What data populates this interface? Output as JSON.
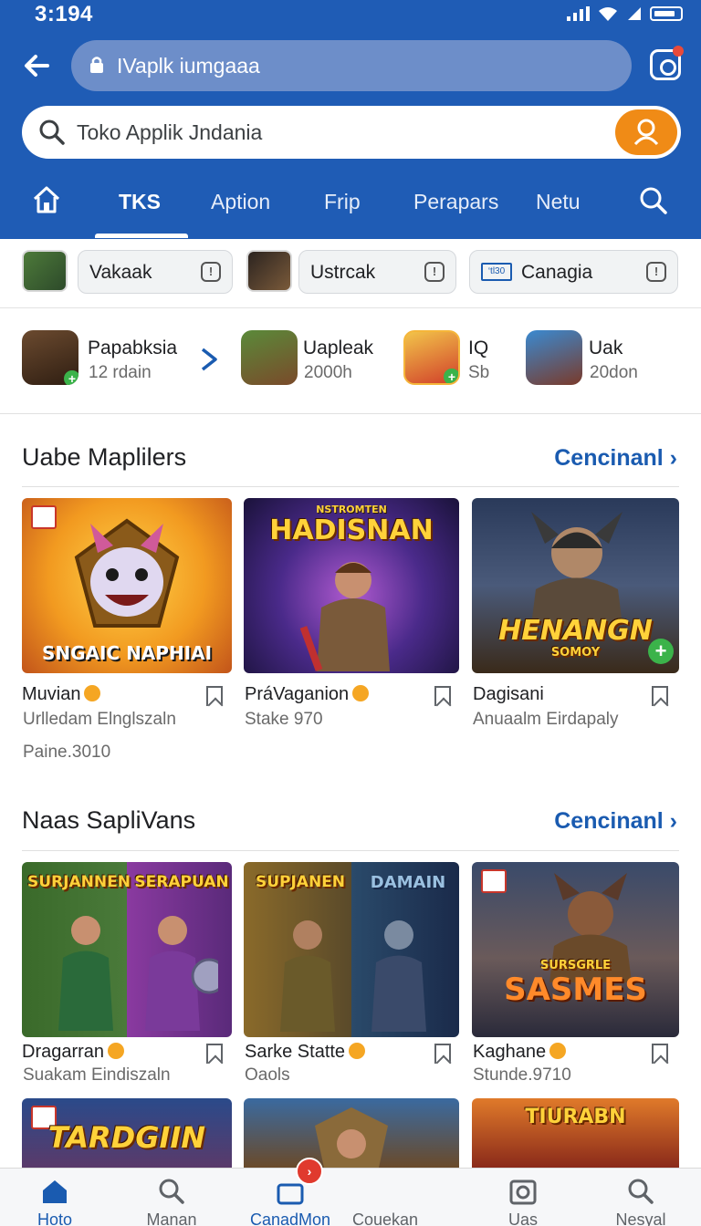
{
  "status_bar": {
    "time": "3:194"
  },
  "url_bar": {
    "text": "IVaplk iumgaaa"
  },
  "search": {
    "text": "Toko Applik Jndania"
  },
  "nav_tabs": [
    "TKS",
    "Aption",
    "Frip",
    "Perapars",
    "Netu"
  ],
  "chips": [
    {
      "label": "Vakaak",
      "icon": "game-thumbnail-icon"
    },
    {
      "label": "Ustrcak",
      "icon": "game-thumbnail-icon"
    },
    {
      "label": "Canagia",
      "icon": "game-thumbnail-icon",
      "badge": "‘tl30"
    }
  ],
  "apps": [
    {
      "name": "Papabksia",
      "sub": "12 rdain"
    },
    {
      "name": "Uapleak",
      "sub": "2000h"
    },
    {
      "name": "IQ",
      "sub": "Sb"
    },
    {
      "name": "Uak",
      "sub": "20don"
    }
  ],
  "section1": {
    "title": "Uabe Maplilers",
    "link": "Cencinanl",
    "cards": [
      {
        "art": "SNGAIC NAPHIAI",
        "title": "Muvian",
        "sub": "Urlledam Elnglszaln",
        "extra": "Paine.3010"
      },
      {
        "art": "HADISNAN",
        "art_small": "NSTROMTEN",
        "title": "PráVaganion",
        "sub": "Stake 970"
      },
      {
        "art": "HENANGN",
        "art_small": "SOMOY",
        "title": "Dagisani",
        "sub": "Anuaalm Eirdapaly"
      }
    ]
  },
  "section2": {
    "title": "Naas SapliVans",
    "link": "Cencinanl",
    "cards": [
      {
        "art": "SURJANNEN",
        "art2": "SERAPUAN",
        "title": "Dragarran",
        "sub": "Suakam Eindiszaln"
      },
      {
        "art": "SUPJANEN",
        "art2": "DAMAIN",
        "title": "Sarke Statte",
        "sub": "Oaols"
      },
      {
        "art": "SASMES",
        "art_small": "SURSGRLE",
        "title": "Kaghane",
        "sub": "Stunde.9710"
      }
    ]
  },
  "section3_cards": [
    {
      "art": "TARDGIIN"
    },
    {
      "art": ""
    },
    {
      "art": "TIURABN"
    }
  ],
  "bottom_nav": [
    {
      "label": "Hoto",
      "icon": "home-icon"
    },
    {
      "label": "Manan",
      "icon": "search-icon"
    },
    {
      "label": "CanadMon",
      "icon": "tv-icon",
      "badge": "›"
    },
    {
      "label": "Couekan",
      "icon": ""
    },
    {
      "label": "Uas",
      "icon": "camera-icon"
    },
    {
      "label": "Nesyal",
      "icon": "search-icon"
    }
  ],
  "colors": {
    "header": "#1f5cb5",
    "accent": "#f08b16",
    "link": "#1a5bb0"
  }
}
